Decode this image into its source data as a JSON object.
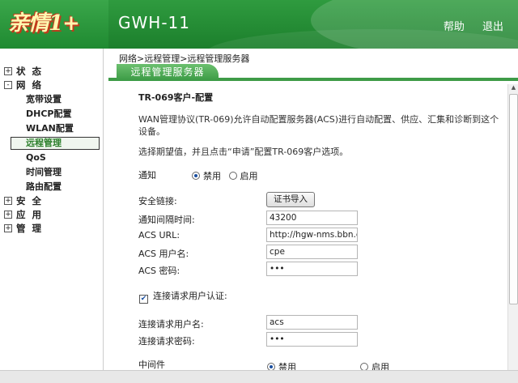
{
  "logo": {
    "text": "亲情1+",
    "watermark": "亲"
  },
  "header": {
    "device": "GWH-11",
    "help": "帮助",
    "logout": "退出"
  },
  "sidebar": {
    "items": [
      {
        "label": "状态",
        "toggle": "+"
      },
      {
        "label": "网络",
        "toggle": "-"
      },
      {
        "label": "安全",
        "toggle": "+"
      },
      {
        "label": "应用",
        "toggle": "+"
      },
      {
        "label": "管理",
        "toggle": "+"
      }
    ],
    "network_sub": [
      "宽带设置",
      "DHCP配置",
      "WLAN配置",
      "远程管理",
      "QoS",
      "时间管理",
      "路由配置"
    ]
  },
  "breadcrumb": "网络>远程管理>远程管理服务器",
  "tab": "远程管理服务器",
  "form": {
    "section_title": "TR-069客户-配置",
    "intro": "WAN管理协议(TR-069)允许自动配置服务器(ACS)进行自动配置、供应、汇集和诊断到这个设备。",
    "instruction": "选择期望值，并且点击“申请”配置TR-069客户选项。",
    "inform_label": "通知",
    "inform_options": [
      "禁用",
      "启用"
    ],
    "inform_selected": "禁用",
    "secure_link_label": "安全链接:",
    "import_cert_button": "证书导入",
    "inform_interval_label": "通知间隔时间:",
    "inform_interval_value": "43200",
    "acs_url_label": "ACS URL:",
    "acs_url_value": "http://hgw-nms.bbn.com",
    "acs_user_label": "ACS 用户名:",
    "acs_user_value": "cpe",
    "acs_pass_label": "ACS 密码:",
    "acs_pass_value": "•••",
    "conn_auth_label": "连接请求用户认证:",
    "conn_auth_checked": true,
    "conn_user_label": "连接请求用户名:",
    "conn_user_value": "acs",
    "conn_pass_label": "连接请求密码:",
    "conn_pass_value": "•••",
    "middleware_label": "中间件",
    "middleware_options": [
      "禁用",
      "启用"
    ],
    "middleware_selected": "禁用"
  }
}
